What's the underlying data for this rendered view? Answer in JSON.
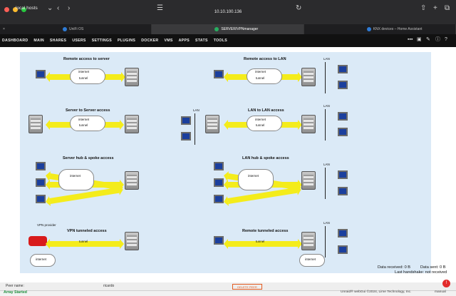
{
  "browser": {
    "sidebar_title": "local hosts",
    "url": "10.10.100.136"
  },
  "tabs": [
    {
      "label": "UniFi OS"
    },
    {
      "label": "SERVER/VPNmanager"
    },
    {
      "label": "KNX devices – Home Assistant"
    }
  ],
  "nav": [
    "DASHBOARD",
    "MAIN",
    "SHARES",
    "USERS",
    "SETTINGS",
    "PLUGINS",
    "DOCKER",
    "VMS",
    "APPS",
    "STATS",
    "TOOLS"
  ],
  "diagrams": {
    "d1": "Remote access to server",
    "d2": "Remote access to LAN",
    "d3": "Server to Server access",
    "d4": "LAN to LAN access",
    "d5": "Server hub & spoke access",
    "d6": "LAN hub & spoke access",
    "d7": "VPN tunneled access",
    "d8": "Remote tunneled access",
    "internet": "internet",
    "tunnel": "tunnel",
    "lan": "LAN",
    "vpn_provider": "VPN\nprovider"
  },
  "stats": {
    "received": "Data received: 0 B",
    "sent": "Data sent: 0 B",
    "handshake": "Last handshake: not received"
  },
  "bottom": {
    "peer": "Peer name:",
    "name": "ricardo",
    "delete": "DELETE PEER"
  },
  "footer": {
    "array": "Array Started",
    "copyright": "Unraid® webGui ©2024, Lime Technology, Inc.",
    "manual": "manual"
  }
}
